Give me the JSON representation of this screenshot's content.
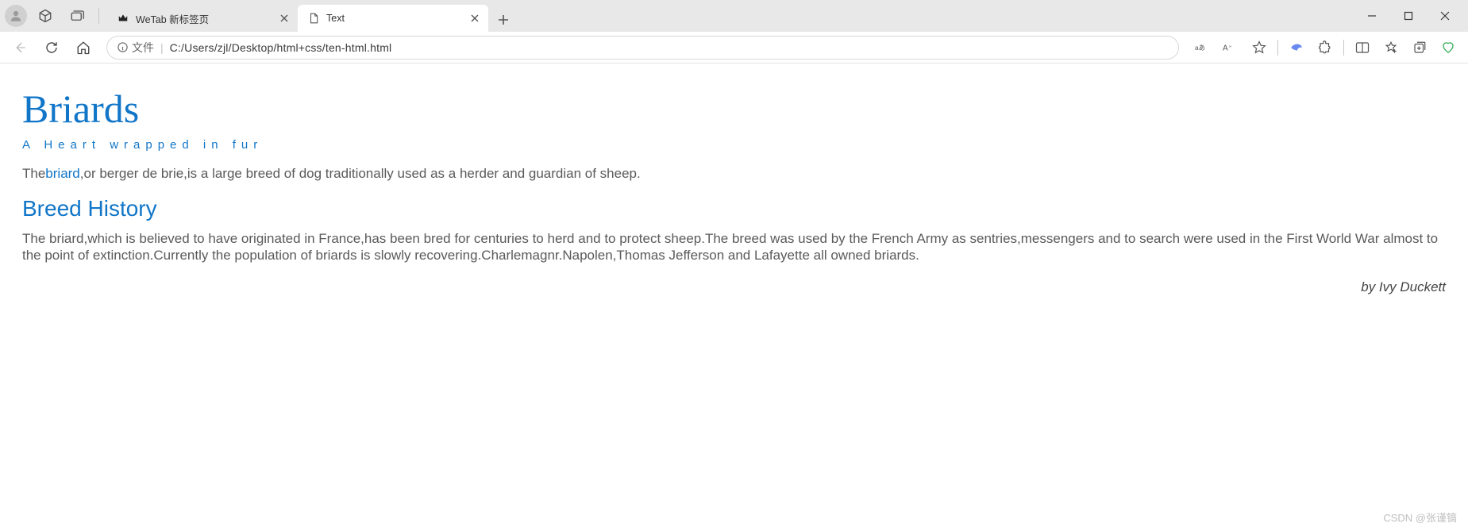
{
  "titlebar": {
    "tabs": [
      {
        "label": "WeTab 新标签页",
        "active": false
      },
      {
        "label": "Text",
        "active": true
      }
    ]
  },
  "addressbar": {
    "secure_label": "文件",
    "url": "C:/Users/zjl/Desktop/html+css/ten-html.html"
  },
  "content": {
    "h1": "Briards",
    "tagline": "A Heart wrapped in fur",
    "intro_pre": "The",
    "intro_link": "briard",
    "intro_post": ",or berger de brie,is a large breed of dog traditionally used as a herder and guardian of sheep.",
    "h2": "Breed History",
    "history": "The briard,which is believed to have originated in France,has been bred for centuries to herd and to protect sheep.The breed was used by the French Army as sentries,messengers and to search were used in the First World War almost to the point of extinction.Currently the population of briards is slowly recovering.Charlemagnr.Napolen,Thomas Jefferson and Lafayette all owned briards.",
    "credit": "by Ivy Duckett"
  },
  "watermark": "CSDN @张谨镐"
}
